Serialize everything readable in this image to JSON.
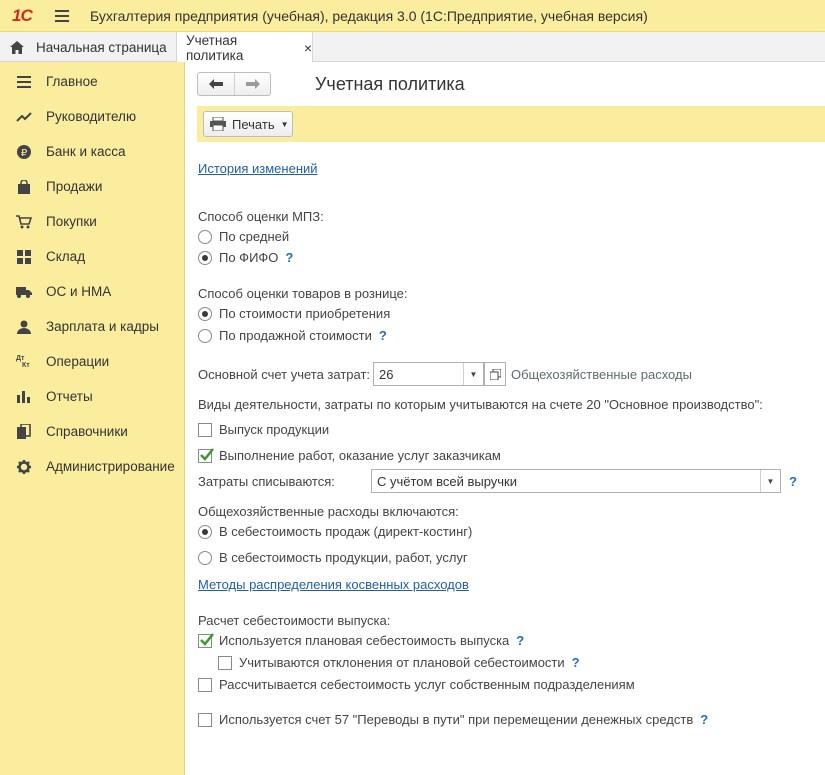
{
  "app": {
    "logo": "1С",
    "title": "Бухгалтерия предприятия (учебная), редакция 3.0  (1С:Предприятие, учебная версия)"
  },
  "tabs": {
    "home_label": "Начальная страница",
    "active_label": "Учетная политика",
    "close_glyph": "×"
  },
  "sidebar": {
    "items": [
      {
        "label": "Главное",
        "icon": "menu-lines-icon"
      },
      {
        "label": "Руководителю",
        "icon": "trend-icon"
      },
      {
        "label": "Банк и касса",
        "icon": "ruble-icon"
      },
      {
        "label": "Продажи",
        "icon": "bag-icon"
      },
      {
        "label": "Покупки",
        "icon": "cart-icon"
      },
      {
        "label": "Склад",
        "icon": "warehouse-icon"
      },
      {
        "label": "ОС и НМА",
        "icon": "truck-icon"
      },
      {
        "label": "Зарплата и кадры",
        "icon": "person-icon"
      },
      {
        "label": "Операции",
        "icon": "dt-kt-icon"
      },
      {
        "label": "Отчеты",
        "icon": "bar-chart-icon"
      },
      {
        "label": "Справочники",
        "icon": "books-icon"
      },
      {
        "label": "Администрирование",
        "icon": "gear-icon"
      }
    ],
    "dtkt_top": "Дт",
    "dtkt_bottom": "Кт"
  },
  "form": {
    "title": "Учетная политика",
    "print_label": "Печать",
    "history_link": "История изменений",
    "mpz": {
      "label": "Способ оценки МПЗ:",
      "options": [
        "По средней",
        "По ФИФО"
      ],
      "selected": 1
    },
    "retail": {
      "label": "Способ оценки товаров в рознице:",
      "options": [
        "По стоимости приобретения",
        "По продажной стоимости"
      ],
      "selected": 0
    },
    "cost_account": {
      "label": "Основной счет учета затрат:",
      "value": "26",
      "description": "Общехозяйственные расходы"
    },
    "activities": {
      "label": "Виды деятельности, затраты по которым учитываются на счете 20 \"Основное производство\":",
      "items": [
        {
          "label": "Выпуск продукции",
          "checked": false
        },
        {
          "label": "Выполнение работ, оказание услуг заказчикам",
          "checked": true
        }
      ]
    },
    "writeoff": {
      "label": "Затраты списываются:",
      "value": "С учётом всей выручки"
    },
    "overhead": {
      "label": "Общехозяйственные расходы включаются:",
      "options": [
        "В себестоимость продаж (директ-костинг)",
        "В  себестоимость продукции, работ, услуг"
      ],
      "selected": 0
    },
    "indirect_link": "Методы распределения косвенных расходов",
    "costing": {
      "label": "Расчет себестоимости выпуска:",
      "planned": {
        "label": "Используется плановая себестоимость выпуска",
        "checked": true
      },
      "deviations": {
        "label": "Учитываются отклонения от плановой себестоимости",
        "checked": false
      },
      "own_units": {
        "label": "Рассчитывается себестоимость услуг собственным подразделениям",
        "checked": false
      }
    },
    "account57": {
      "label": "Используется счет 57 \"Переводы в пути\" при перемещении денежных средств",
      "checked": false
    },
    "help_glyph": "?"
  },
  "colors": {
    "panel_yellow": "#fbed9e",
    "link_blue": "#1f5fa6",
    "check_green": "#3a9a2e",
    "logo_red": "#d22b1e"
  }
}
